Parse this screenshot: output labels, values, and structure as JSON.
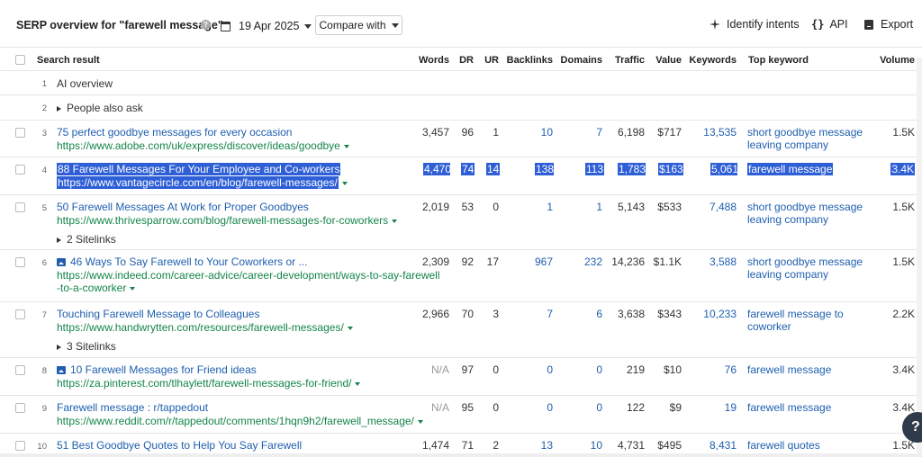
{
  "toolbar": {
    "title": "SERP overview for \"farewell message\"",
    "help_glyph": "?",
    "date": "19 Apr 2025",
    "compare_label": "Compare with",
    "identify_label": "Identify intents",
    "api_glyph": "{}",
    "api_label": "API",
    "export_label": "Export"
  },
  "columns": {
    "search_result": "Search result",
    "words": "Words",
    "dr": "DR",
    "ur": "UR",
    "backlinks": "Backlinks",
    "domains": "Domains",
    "traffic": "Traffic",
    "value": "Value",
    "keywords": "Keywords",
    "top_keyword": "Top keyword",
    "volume": "Volume"
  },
  "special_rows": [
    {
      "num": "1",
      "label": "AI overview"
    },
    {
      "num": "2",
      "label": "People also ask"
    }
  ],
  "rows": [
    {
      "num": "3",
      "title": "75 perfect goodbye messages for every occasion",
      "url": "https://www.adobe.com/uk/express/discover/ideas/goodbye",
      "words": "3,457",
      "dr": "96",
      "ur": "1",
      "backlinks": "10",
      "domains": "7",
      "traffic": "6,198",
      "value": "$717",
      "keywords": "13,535",
      "top_keyword": "short goodbye message leaving company",
      "volume": "1.5K"
    },
    {
      "num": "4",
      "title": "88 Farewell Messages For Your Employee and Co-workers",
      "url": "https://www.vantagecircle.com/en/blog/farewell-messages/",
      "words": "4,470",
      "dr": "74",
      "ur": "14",
      "backlinks": "138",
      "domains": "113",
      "traffic": "1,783",
      "value": "$163",
      "keywords": "5,061",
      "top_keyword": "farewell message",
      "volume": "3.4K"
    },
    {
      "num": "5",
      "title": "50 Farewell Messages At Work for Proper Goodbyes",
      "url": "https://www.thrivesparrow.com/blog/farewell-messages-for-coworkers",
      "sitelinks": "2 Sitelinks",
      "words": "2,019",
      "dr": "53",
      "ur": "0",
      "backlinks": "1",
      "domains": "1",
      "traffic": "5,143",
      "value": "$533",
      "keywords": "7,488",
      "top_keyword": "short goodbye message leaving company",
      "volume": "1.5K"
    },
    {
      "num": "6",
      "title": "46 Ways To Say Farewell to Your Coworkers or ...",
      "url_line1": "https://www.indeed.com/career-advice/career-development/ways-to-say-farewell",
      "url_line2": "-to-a-coworker",
      "words": "2,309",
      "dr": "92",
      "ur": "17",
      "backlinks": "967",
      "domains": "232",
      "traffic": "14,236",
      "value": "$1.1K",
      "keywords": "3,588",
      "top_keyword": "short goodbye message leaving company",
      "volume": "1.5K"
    },
    {
      "num": "7",
      "title": "Touching Farewell Message to Colleagues",
      "url": "https://www.handwrytten.com/resources/farewell-messages/",
      "sitelinks": "3 Sitelinks",
      "words": "2,966",
      "dr": "70",
      "ur": "3",
      "backlinks": "7",
      "domains": "6",
      "traffic": "3,638",
      "value": "$343",
      "keywords": "10,233",
      "top_keyword": "farewell message to coworker",
      "volume": "2.2K"
    },
    {
      "num": "8",
      "title": "10 Farewell Messages for Friend ideas",
      "url": "https://za.pinterest.com/tlhaylett/farewell-messages-for-friend/",
      "words": "N/A",
      "dr": "97",
      "ur": "0",
      "backlinks": "0",
      "domains": "0",
      "traffic": "219",
      "value": "$10",
      "keywords": "76",
      "top_keyword": "farewell message",
      "volume": "3.4K"
    },
    {
      "num": "9",
      "title": "Farewell message : r/tappedout",
      "url": "https://www.reddit.com/r/tappedout/comments/1hqn9h2/farewell_message/",
      "words": "N/A",
      "dr": "95",
      "ur": "0",
      "backlinks": "0",
      "domains": "0",
      "traffic": "122",
      "value": "$9",
      "keywords": "19",
      "top_keyword": "farewell message",
      "volume": "3.4K"
    },
    {
      "num": "10",
      "title": "51 Best Goodbye Quotes to Help You Say Farewell",
      "words": "1,474",
      "dr": "71",
      "ur": "2",
      "backlinks": "13",
      "domains": "10",
      "traffic": "4,731",
      "value": "$495",
      "keywords": "8,431",
      "top_keyword": "farewell quotes",
      "volume": "1.5K"
    }
  ],
  "help_fab_glyph": "?",
  "colors": {
    "link": "#1f5fae",
    "url": "#14844a",
    "selection": "#2e5fd6"
  }
}
